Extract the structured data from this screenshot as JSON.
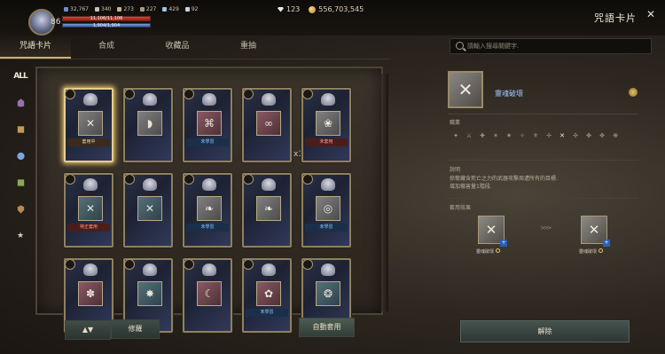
{
  "player": {
    "level": "86",
    "resources": [
      "32,767",
      "340",
      "273",
      "227",
      "429",
      "92"
    ],
    "hp_text": "11,106/11,106",
    "mp_text": "1,904/1,904",
    "hp_fraction": 1.0,
    "mp_fraction": 1.0
  },
  "currency": {
    "gems": "123",
    "gold": "556,703,545"
  },
  "header": {
    "title": "咒語卡片"
  },
  "tabs": [
    {
      "label": "咒語卡片",
      "active": true
    },
    {
      "label": "合成",
      "active": false
    },
    {
      "label": "收藏品",
      "active": false
    },
    {
      "label": "重抽",
      "active": false
    }
  ],
  "search": {
    "placeholder": "請輸入搜尋關鍵字."
  },
  "filters": {
    "all_label": "ALL"
  },
  "cards": [
    {
      "label": "套用中",
      "label_style": "brown",
      "glyph": "✕",
      "art": "stone",
      "selected": true,
      "count": ""
    },
    {
      "label": "",
      "label_style": "",
      "glyph": "◗",
      "art": "stone",
      "selected": false,
      "count": ""
    },
    {
      "label": "未學習",
      "label_style": "blue",
      "glyph": "⌘",
      "art": "pink",
      "selected": false,
      "count": ""
    },
    {
      "label": "",
      "label_style": "",
      "glyph": "∞",
      "art": "pink",
      "selected": false,
      "count": "x1"
    },
    {
      "label": "未套用",
      "label_style": "red",
      "glyph": "❀",
      "art": "stone",
      "selected": false,
      "count": ""
    },
    {
      "label": "特正套用",
      "label_style": "red",
      "glyph": "✕",
      "art": "teal",
      "selected": false,
      "count": ""
    },
    {
      "label": "",
      "label_style": "",
      "glyph": "✕",
      "art": "teal",
      "selected": false,
      "count": ""
    },
    {
      "label": "未學習",
      "label_style": "blue",
      "glyph": "❧",
      "art": "stone",
      "selected": false,
      "count": ""
    },
    {
      "label": "",
      "label_style": "",
      "glyph": "❧",
      "art": "stone",
      "selected": false,
      "count": ""
    },
    {
      "label": "未學習",
      "label_style": "blue",
      "glyph": "◎",
      "art": "stone",
      "selected": false,
      "count": ""
    },
    {
      "label": "",
      "label_style": "",
      "glyph": "✽",
      "art": "pink",
      "selected": false,
      "count": ""
    },
    {
      "label": "",
      "label_style": "",
      "glyph": "✸",
      "art": "teal",
      "selected": false,
      "count": ""
    },
    {
      "label": "",
      "label_style": "",
      "glyph": "☾",
      "art": "pink",
      "selected": false,
      "count": ""
    },
    {
      "label": "未學習",
      "label_style": "blue",
      "glyph": "✿",
      "art": "pink",
      "selected": false,
      "count": ""
    },
    {
      "label": "",
      "label_style": "",
      "glyph": "❂",
      "art": "teal",
      "selected": false,
      "count": ""
    }
  ],
  "bottom": {
    "sort_label": "▲▼",
    "repair_label": "修羅",
    "auto_apply_label": "自動套用"
  },
  "detail": {
    "name": "靈魂破壞",
    "job_section_label": "職業",
    "desc_section_label": "說明",
    "description_lines": [
      "掠奪藏含死亡之力的武器攻擊周遭所有的目標.",
      "增加傷害量1階段."
    ],
    "tier_section_label": "套用效果",
    "tier_from_label": "靈魂破壞",
    "tier_to_label": "靈魂破壞",
    "arrow": ">>>"
  },
  "remove_button": {
    "label": "解除"
  }
}
